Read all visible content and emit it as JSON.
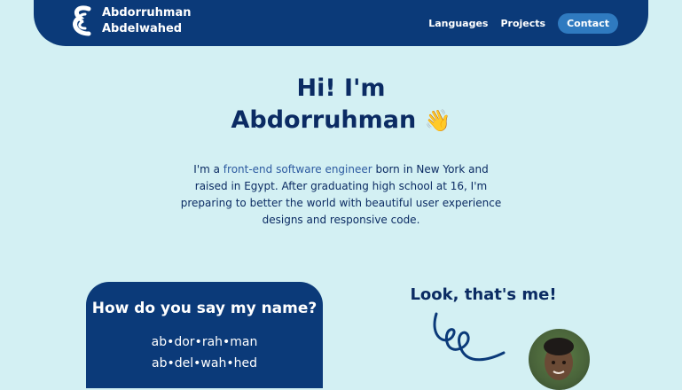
{
  "header": {
    "brand_line1": "Abdorruhman",
    "brand_line2": "Abdelwahed",
    "nav": [
      "Languages",
      "Projects"
    ],
    "contact": "Contact"
  },
  "hero": {
    "greeting": "Hi! I'm",
    "name": "Abdorruhman",
    "wave": "👋"
  },
  "intro": {
    "part1": "I'm a ",
    "highlight": "front-end software engineer",
    "part2": " born in New York and raised in Egypt. After graduating high school at 16, I'm preparing to better the world with beautiful user experience designs and responsive code."
  },
  "card": {
    "title": "How do you say my name?",
    "line1": "ab•dor•rah•man",
    "line2": "ab•del•wah•hed"
  },
  "look": {
    "title": "Look, that's me!"
  },
  "colors": {
    "primary": "#0b3a79",
    "background": "#d3f0f3",
    "accent": "#2f7ac0"
  }
}
